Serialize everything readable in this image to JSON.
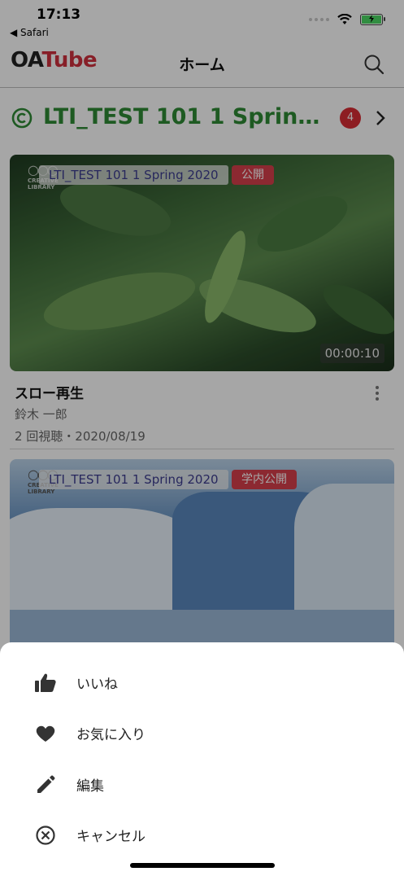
{
  "status_bar": {
    "time": "17:13",
    "back_app": "◀ Safari"
  },
  "header": {
    "logo_part1": "OA",
    "logo_part2": "Tube",
    "title": "ホーム",
    "search_icon": "search-icon"
  },
  "channel": {
    "title": "LTI_TEST 101 1 Spring 2...",
    "badge_count": "4"
  },
  "videos": [
    {
      "course": "LTI_TEST 101 1 Spring 2020",
      "status": "公開",
      "duration": "00:00:10",
      "title": "スロー再生",
      "author": "鈴木 一郎",
      "meta": "2 回視聴・2020/08/19",
      "watermark": "CREATIVE LIBRARY"
    },
    {
      "course": "LTI_TEST 101 1 Spring 2020",
      "status": "学内公開",
      "watermark": "CREATIVE LIBRARY"
    }
  ],
  "action_sheet": {
    "items": [
      {
        "label": "いいね",
        "icon": "thumbs-up-icon"
      },
      {
        "label": "お気に入り",
        "icon": "heart-icon"
      },
      {
        "label": "編集",
        "icon": "pencil-icon"
      },
      {
        "label": "キャンセル",
        "icon": "cancel-circle-icon"
      }
    ]
  },
  "colors": {
    "brand_red": "#d0303e",
    "channel_green": "#2e8b35",
    "badge_red": "#d92d35",
    "status_red": "#d8404c"
  }
}
